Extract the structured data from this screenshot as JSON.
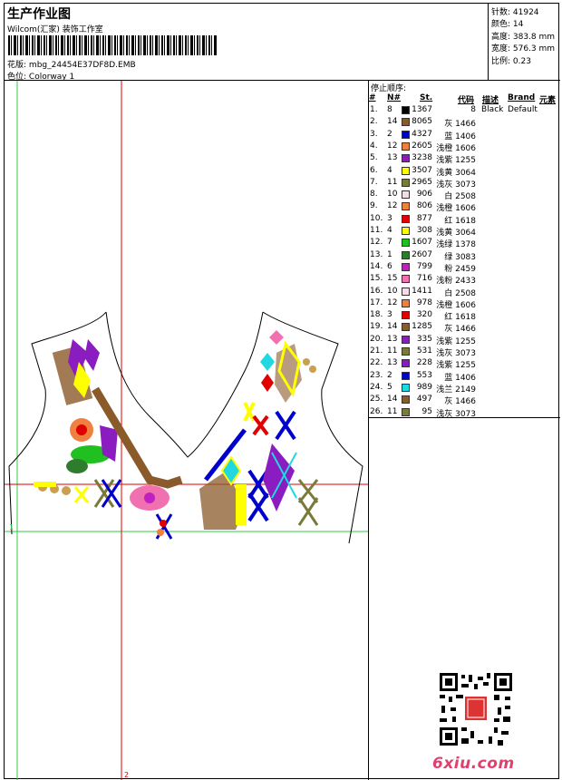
{
  "header": {
    "title": "生产作业图",
    "studio": "Wilcom(汇家) 装饰工作室",
    "design_label": "花版:",
    "design_file": "mbg_24454E37DF8D.EMB",
    "colorway_label": "色位:",
    "colorway": "Colorway 1"
  },
  "stats": {
    "stitches": "针数: 41924",
    "colors": "颜色: 14",
    "height": "高度: 383.8 mm",
    "width": "宽度: 576.3 mm",
    "scale": "比例: 0.23"
  },
  "legend": {
    "title": "停止顺序:",
    "headers": {
      "num": "#",
      "needle": "N#",
      "st": "St.",
      "code": "代码",
      "desc": "描述",
      "brand": "Brand",
      "elem": "元素"
    },
    "rows": [
      {
        "num": "1.",
        "needle": "8",
        "color": "#000000",
        "st": "1367",
        "code": "8",
        "desc": "Black",
        "brand": "Default"
      },
      {
        "num": "2.",
        "needle": "14",
        "color": "#8b5a2b",
        "st": "8065",
        "code": "灰 1466"
      },
      {
        "num": "3.",
        "needle": "2",
        "color": "#0000cc",
        "st": "4327",
        "code": "蓝 1406"
      },
      {
        "num": "4.",
        "needle": "12",
        "color": "#f08040",
        "st": "2605",
        "code": "浅橙 1606"
      },
      {
        "num": "5.",
        "needle": "13",
        "color": "#8a1cc0",
        "st": "3238",
        "code": "浅紫 1255"
      },
      {
        "num": "6.",
        "needle": "4",
        "color": "#ffff00",
        "st": "3507",
        "code": "浅黄 3064"
      },
      {
        "num": "7.",
        "needle": "11",
        "color": "#7a7a3a",
        "st": "2965",
        "code": "浅灰 3073"
      },
      {
        "num": "8.",
        "needle": "10",
        "color": "#f5dce8",
        "st": "906",
        "code": "白 2508"
      },
      {
        "num": "9.",
        "needle": "12",
        "color": "#f08040",
        "st": "806",
        "code": "浅橙 1606"
      },
      {
        "num": "10.",
        "needle": "3",
        "color": "#e00000",
        "st": "877",
        "code": "红 1618"
      },
      {
        "num": "11.",
        "needle": "4",
        "color": "#ffff00",
        "st": "308",
        "code": "浅黄 3064"
      },
      {
        "num": "12.",
        "needle": "7",
        "color": "#20c020",
        "st": "1607",
        "code": "浅绿 1378"
      },
      {
        "num": "13.",
        "needle": "1",
        "color": "#2e7d2e",
        "st": "2607",
        "code": "绿 3083"
      },
      {
        "num": "14.",
        "needle": "6",
        "color": "#c020c0",
        "st": "799",
        "code": "粉 2459"
      },
      {
        "num": "15.",
        "needle": "15",
        "color": "#f070b0",
        "st": "716",
        "code": "浅粉 2433"
      },
      {
        "num": "16.",
        "needle": "10",
        "color": "#f5dce8",
        "st": "1411",
        "code": "白 2508"
      },
      {
        "num": "17.",
        "needle": "12",
        "color": "#f08040",
        "st": "978",
        "code": "浅橙 1606"
      },
      {
        "num": "18.",
        "needle": "3",
        "color": "#e00000",
        "st": "320",
        "code": "红 1618"
      },
      {
        "num": "19.",
        "needle": "14",
        "color": "#8b5a2b",
        "st": "1285",
        "code": "灰 1466"
      },
      {
        "num": "20.",
        "needle": "13",
        "color": "#8a1cc0",
        "st": "335",
        "code": "浅紫 1255"
      },
      {
        "num": "21.",
        "needle": "11",
        "color": "#7a7a3a",
        "st": "531",
        "code": "浅灰 3073"
      },
      {
        "num": "22.",
        "needle": "13",
        "color": "#8a1cc0",
        "st": "228",
        "code": "浅紫 1255"
      },
      {
        "num": "23.",
        "needle": "2",
        "color": "#0000cc",
        "st": "553",
        "code": "蓝 1406"
      },
      {
        "num": "24.",
        "needle": "5",
        "color": "#20d8e0",
        "st": "989",
        "code": "浅兰 2149"
      },
      {
        "num": "25.",
        "needle": "14",
        "color": "#8b5a2b",
        "st": "497",
        "code": "灰 1466"
      },
      {
        "num": "26.",
        "needle": "11",
        "color": "#7a7a3a",
        "st": "95",
        "code": "浅灰 3073"
      }
    ]
  },
  "canvas": {
    "marker_1": "1",
    "marker_2": "2"
  },
  "watermark": "6xiu.com"
}
